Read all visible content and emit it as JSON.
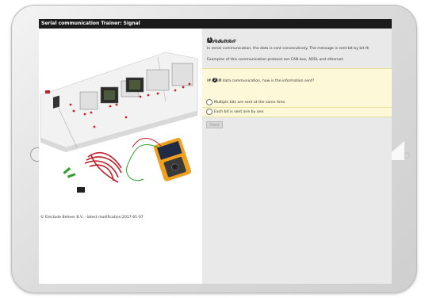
{
  "app": {
    "title": "Serial communication Trainer: Signal",
    "copyright": "© Electude Beheer B.V. - latest modification:2017-01-07"
  },
  "lesson": {
    "page_dots": [
      "1",
      "",
      "",
      "",
      "",
      ""
    ],
    "active_page": "1",
    "intro_title": "Introduction",
    "paragraph_1": "In serial communication, the data is sent consecutively. The message is sent bit by bit th",
    "paragraph_2": "Examples of this communication protocol are CAN bus, ADSL and ethernet."
  },
  "question": {
    "sub_active": "2",
    "text": "In serial data communication, how is the information sent?",
    "options": [
      "Multiple bits are sent at the same time.",
      "Each bit is sent one by one."
    ],
    "check_label": "Check"
  },
  "colors": {
    "titlebar": "#1b1b1b",
    "question_bg": "#fdf9d8",
    "panel_bg": "#e9e9e9",
    "trainer_leads": "#c0202a",
    "probe_lead": "#2aa02a",
    "scope_body": "#f0a020"
  },
  "icons": {
    "home": "home-button-icon",
    "radio": "radio-icon"
  }
}
